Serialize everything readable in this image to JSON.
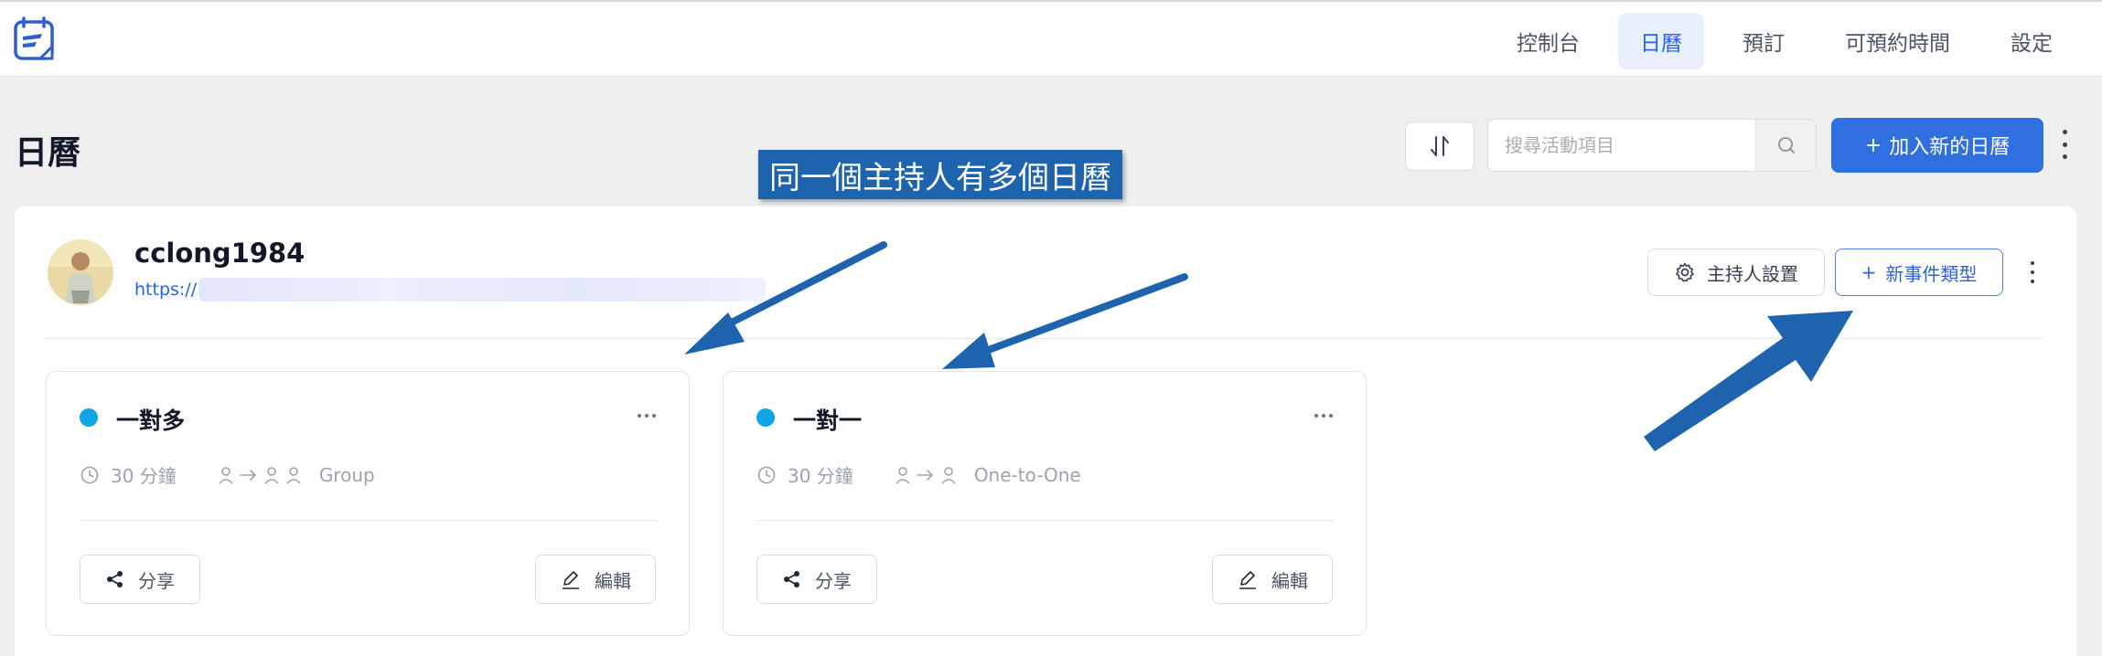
{
  "nav": {
    "items": [
      {
        "label": "控制台",
        "active": false
      },
      {
        "label": "日曆",
        "active": true
      },
      {
        "label": "預訂",
        "active": false
      },
      {
        "label": "可預約時間",
        "active": false
      },
      {
        "label": "設定",
        "active": false
      }
    ]
  },
  "page": {
    "title": "日曆",
    "search_placeholder": "搜尋活動項目",
    "add_calendar_label": "加入新的日曆",
    "add_icon": "plus-icon",
    "sort_icon": "sort-arrows-icon",
    "search_icon": "search-icon"
  },
  "host": {
    "name": "cclong1984",
    "link_prefix": "https://",
    "settings_label": "主持人設置",
    "new_event_label": "新事件類型",
    "settings_icon": "gear-icon"
  },
  "cards": [
    {
      "title": "一對多",
      "duration": "30 分鐘",
      "type_label": "Group",
      "dot_color": "#0ea5e9",
      "share_label": "分享",
      "edit_label": "編輯"
    },
    {
      "title": "一對一",
      "duration": "30 分鐘",
      "type_label": "One-to-One",
      "dot_color": "#0ea5e9",
      "share_label": "分享",
      "edit_label": "編輯"
    }
  ],
  "annotation": {
    "label": "同一個主持人有多個日曆",
    "color": "#1d63ad"
  },
  "colors": {
    "accent": "#2f6fdf",
    "active_nav_bg": "#e8f0fb",
    "event_dot": "#0ea5e9"
  }
}
